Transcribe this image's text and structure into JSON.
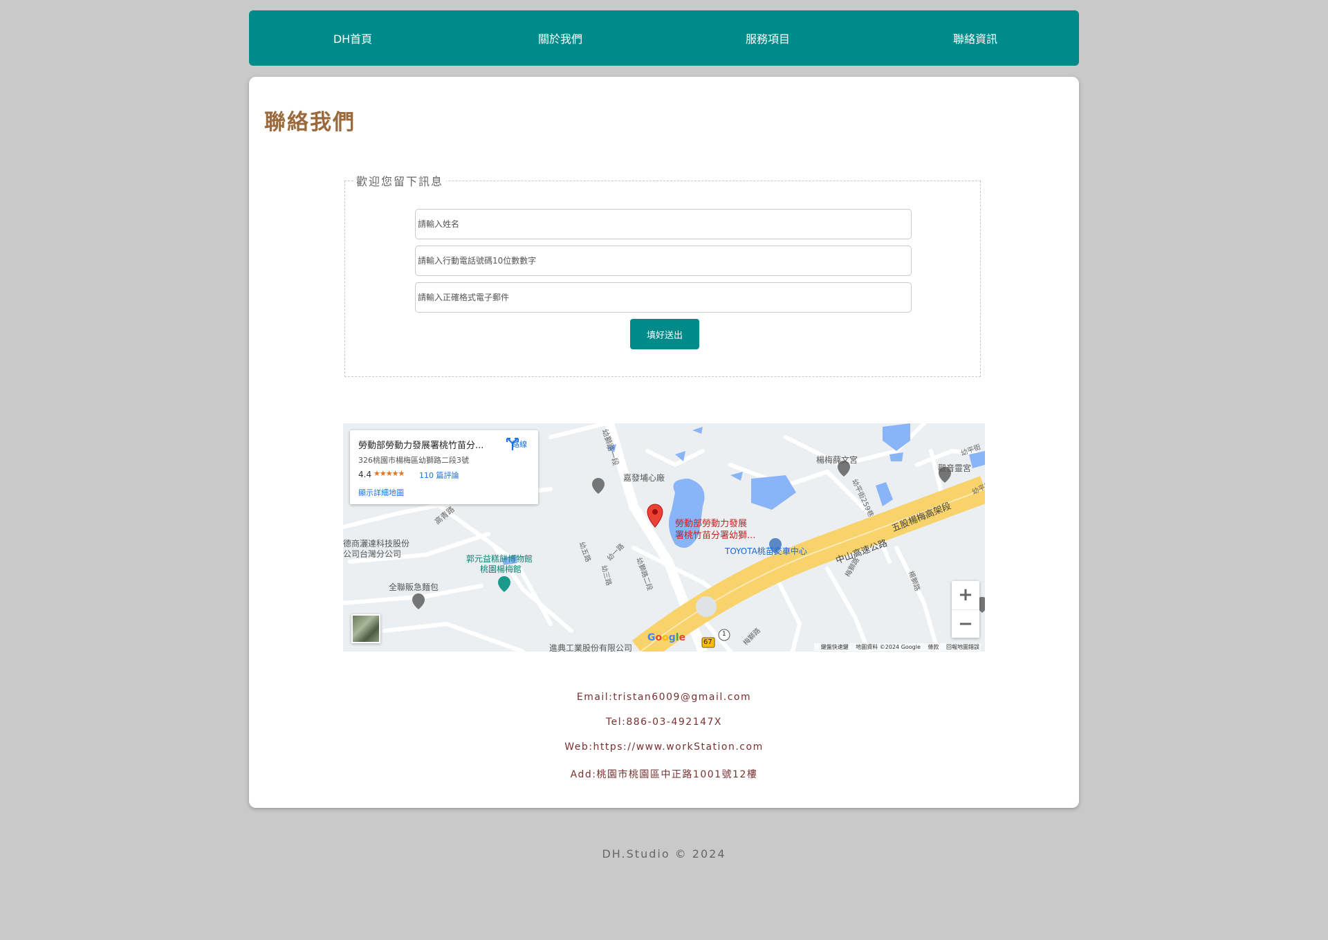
{
  "nav": {
    "home": "DH首頁",
    "about": "關於我們",
    "services": "服務項目",
    "contact": "聯絡資訊"
  },
  "page": {
    "title": "聯絡我們"
  },
  "form": {
    "legend": "歡迎您留下訊息",
    "name_placeholder": "請輸入姓名",
    "phone_placeholder": "請輸入行動電話號碼10位數數字",
    "email_placeholder": "請輸入正確格式電子郵件",
    "submit_label": "填好送出"
  },
  "map": {
    "place_name": "勞動部勞動力發展署桃竹苗分...",
    "place_address": "326桃園市楊梅區幼獅路二段3號",
    "rating": "4.4",
    "stars": "★★★★★",
    "reviews": "110 篇評論",
    "view_larger": "顯示詳細地圖",
    "directions": "路線",
    "labels": {
      "road_top": "幼獅路一段",
      "jiafa": "嘉發埔心廠",
      "marker_line1": "勞動部勞動力發展",
      "marker_line2": "署桃竹苗分署幼獅...",
      "toyota": "TOYOTA桃苗交車中心",
      "yangmei_temple": "楊梅薛文宮",
      "guanyin": "觀音靈宮",
      "youping": "幼平街",
      "youping2": "幼平街",
      "youping_lane": "幼平街259巷",
      "freeway": "中山高速公路",
      "elevated": "五股楊梅高架段",
      "gaoqing": "高青路",
      "company1_l1": "德商灑達科技股份",
      "company1_l2": "公司台灣分公司",
      "museum_l1": "郭元益糕餅博物館",
      "museum_l2": "桃園楊梅館",
      "quanlian": "全聯販急麵包",
      "jindian": "進典工業股份有限公司",
      "you5": "幼五路",
      "you1": "幼一路",
      "you3": "幼三路",
      "youshi2": "幼獅路二段",
      "meishi": "梅獅路",
      "meishi2": "梅獅路",
      "meishi3": "楊獅路",
      "route67": "67",
      "route1": "1"
    },
    "google": "Google",
    "attribution": {
      "shortcuts": "鍵盤快速鍵",
      "data": "地圖資料 ©2024 Google",
      "terms": "條款",
      "report": "回報地圖錯誤"
    },
    "zoom_in": "+",
    "zoom_out": "−"
  },
  "contact": {
    "email": "Email:tristan6009@gmail.com",
    "tel": "Tel:886-03-492147X",
    "web": "Web:https://www.workStation.com",
    "address": "Add:桃園市桃園區中正路1001號12樓"
  },
  "footer": "DH.Studio © 2024",
  "colors": {
    "nav": "#008b8b",
    "title": "#9b6a3c",
    "contact_text": "#7a2f2f",
    "background": "#c9c9c9"
  }
}
